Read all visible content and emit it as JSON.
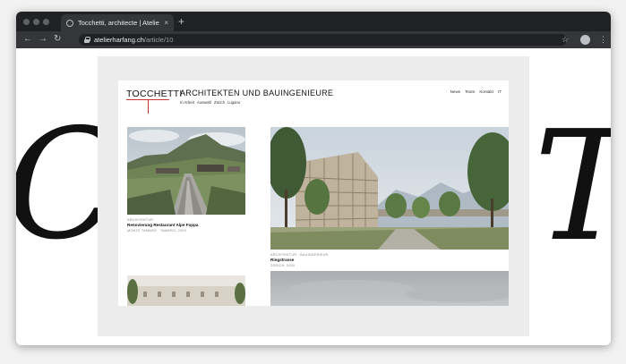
{
  "browser": {
    "tab_title": "Tocchetti, architecte | Atelier H",
    "tab_close": "×",
    "new_tab": "+",
    "url_domain": "atelierharfang.ch",
    "url_path": "/article/10",
    "colors": {
      "tabbar": "#202124",
      "toolbar": "#35363a",
      "omnibox": "#202124"
    }
  },
  "background": {
    "left_glyph": "C",
    "right_glyph": "T"
  },
  "site": {
    "logo": "TOCCHETTI",
    "headline": "ARCHITEKTEN UND BAUINGENIEURE",
    "subnav": [
      "In Arbeit",
      "Auswahl",
      "Zürich",
      "Lugano"
    ],
    "nav": [
      "News",
      "Team",
      "Kontakt",
      "IT"
    ],
    "accent_color": "#c8372d",
    "projects": [
      {
        "category": "ARCHITEKTUR",
        "title": "Renovierung Restaurant Alpe Foppa",
        "details": "MONTE TAMARO · TAMARO, 2020"
      },
      {
        "category": "ARCHITEKTUR · BAUINGENIEUR",
        "title": "Ringstrasse",
        "details": "ZÜRICH, 2020"
      }
    ]
  }
}
